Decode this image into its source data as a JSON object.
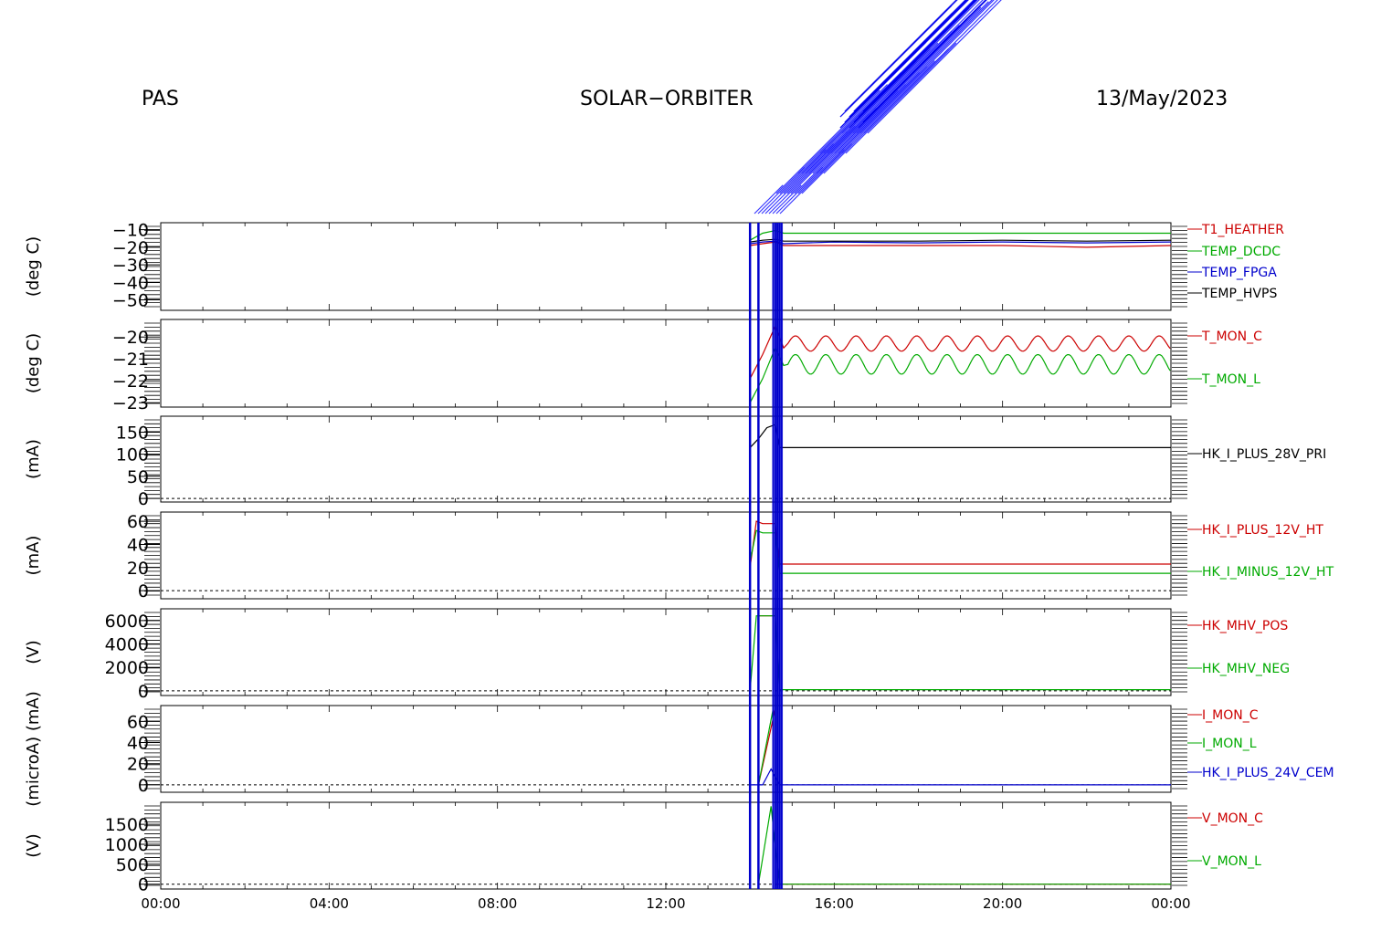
{
  "header": {
    "left": "PAS",
    "center": "SOLAR−ORBITER",
    "right": "13/May/2023"
  },
  "chart_data": {
    "type": "line",
    "x_unit": "time of day (hours)",
    "x_range": [
      0,
      24
    ],
    "x_ticks": [
      {
        "v": 0,
        "label": "00:00"
      },
      {
        "v": 4,
        "label": "04:00"
      },
      {
        "v": 8,
        "label": "08:00"
      },
      {
        "v": 12,
        "label": "12:00"
      },
      {
        "v": 16,
        "label": "16:00"
      },
      {
        "v": 20,
        "label": "20:00"
      },
      {
        "v": 24,
        "label": "00:00"
      }
    ],
    "event_markers_hours": [
      14.0,
      14.2,
      14.55,
      14.6,
      14.65,
      14.7,
      14.75
    ],
    "colors": {
      "red": "#cc0000",
      "green": "#00aa00",
      "blue": "#0000cc",
      "black": "#000000"
    },
    "panels": [
      {
        "id": "temps",
        "ylabel": "(deg C)",
        "ylim": [
          -56,
          -6
        ],
        "yticks": [
          -10,
          -20,
          -30,
          -40,
          -50
        ],
        "ytick_labels": [
          "−10",
          "−20",
          "−30",
          "−40",
          "−50"
        ],
        "zero_line": false,
        "series": [
          {
            "name": "T1_HEATHER",
            "color": "#cc0000",
            "points": [
              [
                14.0,
                -19
              ],
              [
                14.3,
                -18
              ],
              [
                14.6,
                -17
              ],
              [
                14.8,
                -19
              ],
              [
                16,
                -19
              ],
              [
                18,
                -19
              ],
              [
                20,
                -19
              ],
              [
                22,
                -20
              ],
              [
                24,
                -19
              ]
            ]
          },
          {
            "name": "TEMP_DCDC",
            "color": "#00aa00",
            "points": [
              [
                14.0,
                -16
              ],
              [
                14.3,
                -12
              ],
              [
                14.6,
                -10.5
              ],
              [
                14.8,
                -12
              ],
              [
                16,
                -12
              ],
              [
                18,
                -12
              ],
              [
                20,
                -12
              ],
              [
                22,
                -12
              ],
              [
                24,
                -12
              ]
            ]
          },
          {
            "name": "TEMP_FPGA",
            "color": "#0000cc",
            "points": [
              [
                14.0,
                -18
              ],
              [
                14.3,
                -17
              ],
              [
                14.6,
                -16.5
              ],
              [
                14.8,
                -18
              ],
              [
                16,
                -17
              ],
              [
                18,
                -17.5
              ],
              [
                20,
                -17
              ],
              [
                22,
                -17.5
              ],
              [
                24,
                -17
              ]
            ]
          },
          {
            "name": "TEMP_HVPS",
            "color": "#000000",
            "points": [
              [
                14.0,
                -17
              ],
              [
                14.3,
                -16
              ],
              [
                14.6,
                -15.5
              ],
              [
                14.8,
                -16.5
              ],
              [
                16,
                -16.5
              ],
              [
                18,
                -16.5
              ],
              [
                20,
                -16
              ],
              [
                22,
                -16.5
              ],
              [
                24,
                -16
              ]
            ]
          }
        ]
      },
      {
        "id": "tmon",
        "ylabel": "(deg C)",
        "ylim": [
          -23.2,
          -19.2
        ],
        "yticks": [
          -20,
          -21,
          -22,
          -23
        ],
        "ytick_labels": [
          "−20",
          "−21",
          "−22",
          "−23"
        ],
        "zero_line": false,
        "series": [
          {
            "name": "T_MON_C",
            "color": "#cc0000",
            "osc": {
              "start": 14.9,
              "end": 24,
              "mean": -20.3,
              "amp": 0.35,
              "period": 0.72
            },
            "points": [
              [
                14.0,
                -21.9
              ],
              [
                14.3,
                -20.8
              ],
              [
                14.6,
                -19.5
              ],
              [
                14.8,
                -20.5
              ]
            ]
          },
          {
            "name": "T_MON_L",
            "color": "#00aa00",
            "osc": {
              "start": 14.9,
              "end": 24,
              "mean": -21.25,
              "amp": 0.45,
              "period": 0.72
            },
            "points": [
              [
                14.0,
                -23.0
              ],
              [
                14.3,
                -21.9
              ],
              [
                14.6,
                -20.5
              ],
              [
                14.8,
                -21.3
              ]
            ]
          }
        ]
      },
      {
        "id": "i28",
        "ylabel": "(mA)",
        "ylim": [
          -8,
          186
        ],
        "yticks": [
          0,
          50,
          100,
          150
        ],
        "ytick_labels": [
          "0",
          "50",
          "100",
          "150"
        ],
        "zero_line": true,
        "series": [
          {
            "name": "HK_I_PLUS_28V_PRI",
            "color": "#000000",
            "points": [
              [
                14.0,
                115
              ],
              [
                14.2,
                135
              ],
              [
                14.4,
                160
              ],
              [
                14.6,
                167
              ],
              [
                14.7,
                115
              ],
              [
                16,
                115
              ],
              [
                20,
                115
              ],
              [
                24,
                115
              ]
            ]
          }
        ]
      },
      {
        "id": "i12",
        "ylabel": "(mA)",
        "ylim": [
          -7,
          68
        ],
        "yticks": [
          0,
          20,
          40,
          60
        ],
        "ytick_labels": [
          "0",
          "20",
          "40",
          "60"
        ],
        "zero_line": true,
        "series": [
          {
            "name": "HK_I_PLUS_12V_HT",
            "color": "#cc0000",
            "points": [
              [
                14.0,
                20
              ],
              [
                14.15,
                60
              ],
              [
                14.3,
                58
              ],
              [
                14.6,
                58
              ],
              [
                14.7,
                23
              ],
              [
                16,
                23
              ],
              [
                20,
                23
              ],
              [
                24,
                23
              ]
            ]
          },
          {
            "name": "HK_I_MINUS_12V_HT",
            "color": "#00aa00",
            "points": [
              [
                14.0,
                25
              ],
              [
                14.15,
                52
              ],
              [
                14.3,
                50
              ],
              [
                14.6,
                50
              ],
              [
                14.7,
                15
              ],
              [
                16,
                15
              ],
              [
                20,
                15
              ],
              [
                24,
                15
              ]
            ]
          }
        ]
      },
      {
        "id": "mhv",
        "ylabel": "(V)",
        "ylim": [
          -400,
          7000
        ],
        "yticks": [
          0,
          2000,
          4000,
          6000
        ],
        "ytick_labels": [
          "0",
          "2000",
          "4000",
          "6000"
        ],
        "zero_line": true,
        "series": [
          {
            "name": "HK_MHV_POS",
            "color": "#cc0000",
            "points": [
              [
                14.2,
                6400
              ],
              [
                14.6,
                6400
              ]
            ]
          },
          {
            "name": "HK_MHV_NEG",
            "color": "#00aa00",
            "points": [
              [
                14.0,
                0
              ],
              [
                14.15,
                6400
              ],
              [
                14.6,
                6400
              ],
              [
                14.7,
                100
              ],
              [
                16,
                100
              ],
              [
                20,
                100
              ],
              [
                24,
                100
              ]
            ]
          }
        ]
      },
      {
        "id": "imon",
        "ylabel": "(microA) (mA)",
        "ylim": [
          -7,
          75
        ],
        "yticks": [
          0,
          20,
          40,
          60
        ],
        "ytick_labels": [
          "0",
          "20",
          "40",
          "60"
        ],
        "zero_line": true,
        "series": [
          {
            "name": "I_MON_C",
            "color": "#cc0000",
            "points": [
              [
                14.2,
                0
              ],
              [
                14.6,
                72
              ]
            ]
          },
          {
            "name": "I_MON_L",
            "color": "#00aa00",
            "points": [
              [
                14.2,
                0
              ],
              [
                14.55,
                72
              ]
            ]
          },
          {
            "name": "HK_I_PLUS_24V_CEM",
            "color": "#0000cc",
            "points": [
              [
                14.0,
                0
              ],
              [
                14.3,
                0
              ],
              [
                14.5,
                15
              ],
              [
                14.7,
                0
              ],
              [
                16,
                0
              ],
              [
                20,
                0
              ],
              [
                24,
                0
              ]
            ]
          }
        ]
      },
      {
        "id": "vmon",
        "ylabel": "(V)",
        "ylim": [
          -120,
          2050
        ],
        "yticks": [
          0,
          500,
          1000,
          1500
        ],
        "ytick_labels": [
          "0",
          "500",
          "1000",
          "1500"
        ],
        "zero_line": true,
        "series": [
          {
            "name": "V_MON_C",
            "color": "#cc0000",
            "points": [
              [
                14.6,
                0
              ],
              [
                14.8,
                0
              ],
              [
                24,
                0
              ]
            ]
          },
          {
            "name": "V_MON_L",
            "color": "#00aa00",
            "points": [
              [
                14.2,
                0
              ],
              [
                14.5,
                1950
              ],
              [
                14.7,
                0
              ],
              [
                16,
                0
              ],
              [
                24,
                0
              ]
            ]
          }
        ]
      }
    ]
  }
}
